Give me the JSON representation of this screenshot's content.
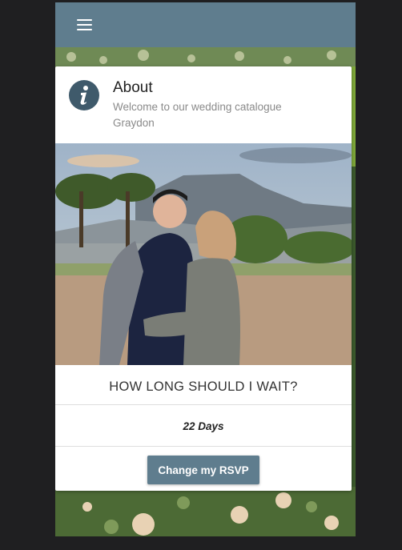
{
  "app_bar": {
    "menu_icon": "hamburger-menu-icon",
    "color": "#5f7d8e"
  },
  "about_card": {
    "icon": "info-icon",
    "title": "About",
    "subtitle": "Welcome to our wedding catalogue Graydon"
  },
  "photo": {
    "description_icon": "couple-photo"
  },
  "countdown": {
    "question": "HOW LONG SHOULD I WAIT?",
    "value": "22 Days"
  },
  "rsvp": {
    "button_label": "Change my RSVP"
  },
  "colors": {
    "accent": "#5f7d8e",
    "page_bg": "#1f1f21",
    "card_bg": "#ffffff"
  }
}
